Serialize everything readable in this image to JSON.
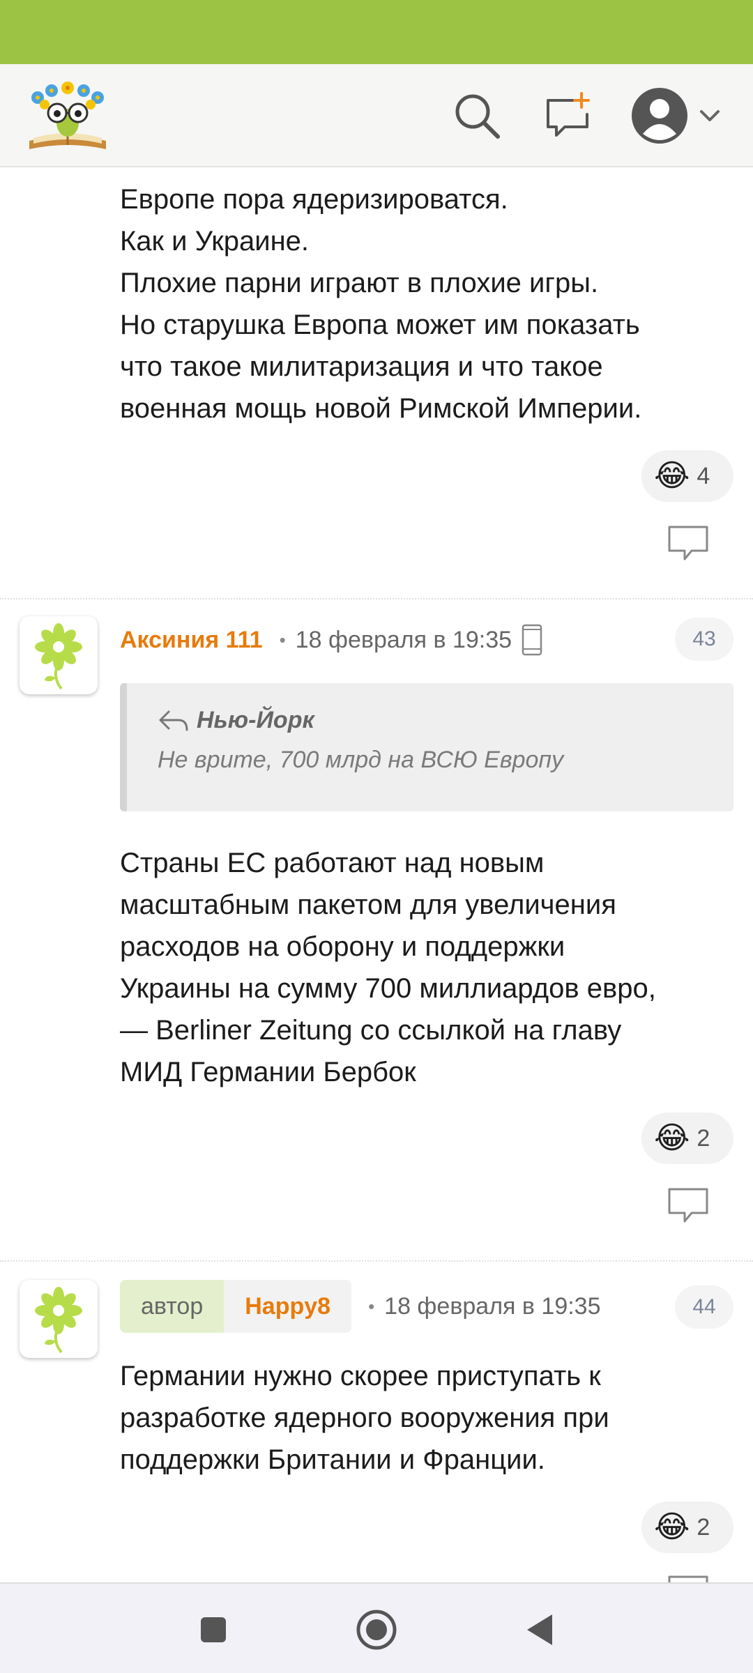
{
  "header": {
    "logo_icon": "bookworm-flowers-logo",
    "search_icon": "search-icon",
    "new_post_icon": "new-message-plus-icon",
    "profile_icon": "user-avatar-icon",
    "dropdown_icon": "chevron-down-icon"
  },
  "colors": {
    "status_bar": "#9dc344",
    "author_accent": "#e77b0c",
    "author_tag_bg": "#e4f0cd"
  },
  "comments": [
    {
      "text_lines": [
        "Европе пора ядеризироватся.",
        "Как и Украине.",
        "Плохие парни играют в плохие игры.",
        "Но старушка Европа может им показать",
        "что такое милитаризация и что такое",
        "военная мощь новой Римской Империи."
      ],
      "reaction": {
        "emoji": "😂",
        "count": "4"
      }
    },
    {
      "author": "Аксиния 111",
      "separator": "•",
      "date": "18 февраля в 19:35",
      "number": "43",
      "quote": {
        "author": "Нью-Йорк",
        "text": "Не врите, 700 млрд на ВСЮ Европу"
      },
      "text_lines": [
        "Страны ЕС работают над новым",
        "масштабным пакетом для увеличения",
        "расходов на оборону и поддержки",
        "Украины на сумму 700 миллиардов евро,",
        "— Berliner Zeitung со ссылкой на главу",
        "МИД Германии Бербок"
      ],
      "reaction": {
        "emoji": "😂",
        "count": "2"
      }
    },
    {
      "author_role": "автор",
      "author": "Happy8",
      "separator": "•",
      "date": "18 февраля в 19:35",
      "number": "44",
      "text_lines": [
        "Германии нужно скорее приступать к",
        "разработке ядерного вооружения при",
        "поддержки Британии и Франции."
      ],
      "reaction": {
        "emoji": "😂",
        "count": "2"
      }
    }
  ],
  "nav": {
    "recents_icon": "square-recents-icon",
    "home_icon": "circle-home-icon",
    "back_icon": "triangle-back-icon"
  }
}
